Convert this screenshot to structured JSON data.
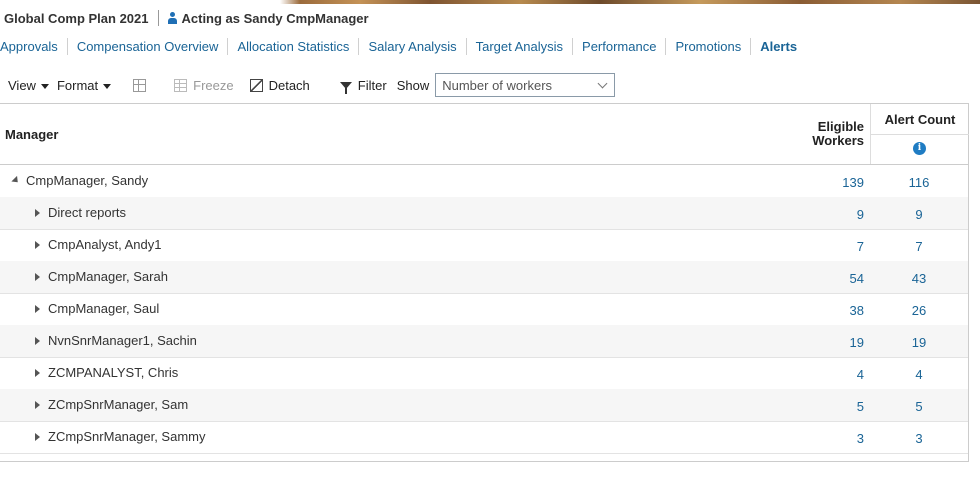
{
  "header": {
    "plan_title": "Global Comp Plan 2021",
    "acting_as": "Acting as Sandy CmpManager"
  },
  "tabs": [
    {
      "label": "Approvals"
    },
    {
      "label": "Compensation Overview"
    },
    {
      "label": "Allocation Statistics"
    },
    {
      "label": "Salary Analysis"
    },
    {
      "label": "Target Analysis"
    },
    {
      "label": "Performance"
    },
    {
      "label": "Promotions"
    },
    {
      "label": "Alerts",
      "active": true
    }
  ],
  "toolbar": {
    "view_label": "View",
    "format_label": "Format",
    "freeze_label": "Freeze",
    "detach_label": "Detach",
    "filter_label": "Filter",
    "show_label": "Show",
    "show_selected": "Number of workers"
  },
  "table": {
    "columns": {
      "manager": "Manager",
      "eligible_line1": "Eligible",
      "eligible_line2": "Workers",
      "alert_count": "Alert Count",
      "info_glyph": "i"
    },
    "rows": [
      {
        "name": "CmpManager, Sandy",
        "eligible": "139",
        "alerts": "116",
        "level": 0,
        "expanded": true
      },
      {
        "name": "Direct reports",
        "eligible": "9",
        "alerts": "9",
        "level": 1
      },
      {
        "name": "CmpAnalyst, Andy1",
        "eligible": "7",
        "alerts": "7",
        "level": 1
      },
      {
        "name": "CmpManager, Sarah",
        "eligible": "54",
        "alerts": "43",
        "level": 1
      },
      {
        "name": "CmpManager, Saul",
        "eligible": "38",
        "alerts": "26",
        "level": 1
      },
      {
        "name": "NvnSnrManager1, Sachin",
        "eligible": "19",
        "alerts": "19",
        "level": 1
      },
      {
        "name": "ZCMPANALYST, Chris",
        "eligible": "4",
        "alerts": "4",
        "level": 1
      },
      {
        "name": "ZCmpSnrManager, Sam",
        "eligible": "5",
        "alerts": "5",
        "level": 1
      },
      {
        "name": "ZCmpSnrManager, Sammy",
        "eligible": "3",
        "alerts": "3",
        "level": 1
      }
    ]
  },
  "colors": {
    "link": "#1a6496",
    "info": "#1f7cc3"
  }
}
